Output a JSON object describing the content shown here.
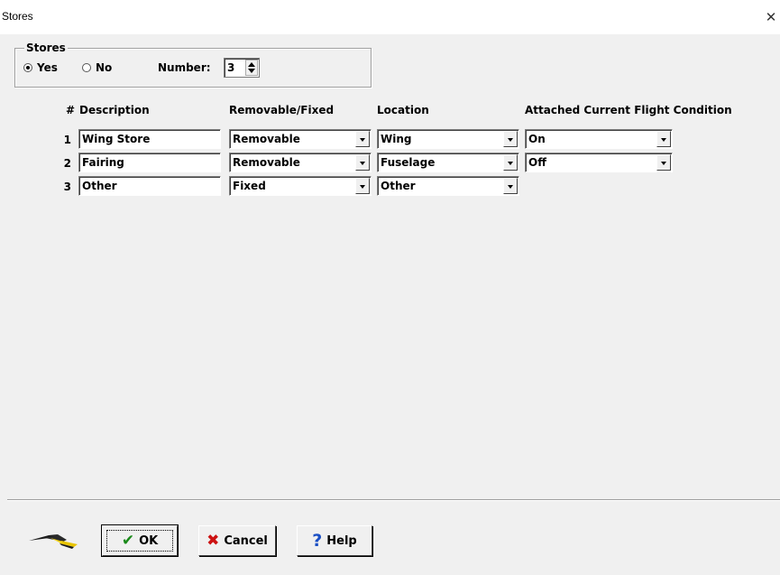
{
  "window": {
    "title": "Stores",
    "close_icon": "close-icon"
  },
  "stores_group": {
    "legend": "Stores",
    "radio_yes": "Yes",
    "radio_no": "No",
    "selected": "Yes",
    "number_label": "Number:",
    "number_value": "3"
  },
  "table": {
    "headers": [
      "#",
      "Description",
      "Removable/Fixed",
      "Location",
      "Attached Current Flight Condition"
    ],
    "rows": [
      {
        "num": "1",
        "description": "Wing Store",
        "removable": "Removable",
        "location": "Wing",
        "attached": "On"
      },
      {
        "num": "2",
        "description": "Fairing",
        "removable": "Removable",
        "location": "Fuselage",
        "attached": "Off"
      },
      {
        "num": "3",
        "description": "Other",
        "removable": "Fixed",
        "location": "Other",
        "attached": null
      }
    ]
  },
  "buttons": {
    "ok": "OK",
    "cancel": "Cancel",
    "help": "Help"
  },
  "colors": {
    "ok_check": "#1a8a1a",
    "cancel_x": "#cc1111",
    "help_q": "#1a4fc4",
    "logo_yellow": "#e8c400"
  }
}
